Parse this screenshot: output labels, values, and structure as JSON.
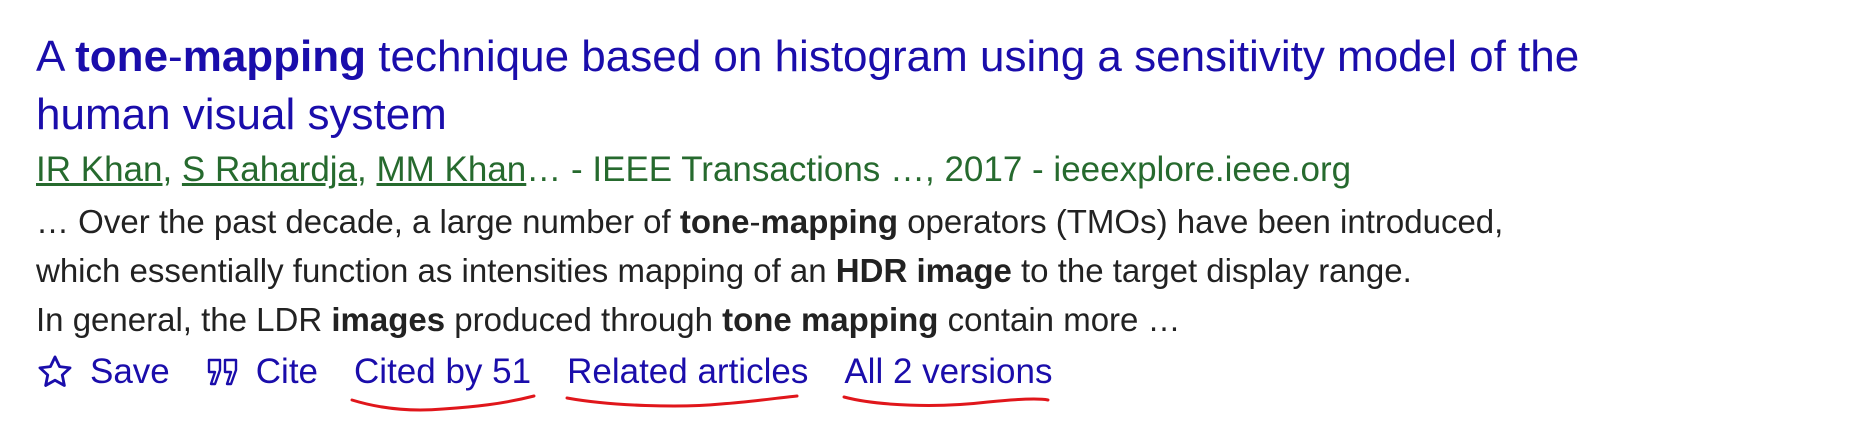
{
  "result": {
    "title_parts": {
      "p1": "A ",
      "p2": "tone",
      "p3": "-",
      "p4": "mapping",
      "p5": " technique based on histogram using a sensitivity model of the",
      "p6": "human visual system"
    },
    "authors": [
      "IR Khan",
      "S Rahardja",
      "MM Khan"
    ],
    "author_sep": ", ",
    "byline_rest": "… - IEEE Transactions …, 2017 - ieeexplore.ieee.org",
    "snippet": {
      "l1a": "… Over the past decade, a large number of ",
      "l1b": "tone",
      "l1c": "-",
      "l1d": "mapping",
      "l1e": " operators (TMOs) have been introduced,",
      "l2a": "which essentially function as intensities mapping of an ",
      "l2b": "HDR image",
      "l2c": " to the target display range.",
      "l3a": "In general, the LDR ",
      "l3b": "images",
      "l3c": " produced through ",
      "l3d": "tone mapping",
      "l3e": " contain more …"
    },
    "actions": {
      "save": "Save",
      "cite": "Cite",
      "cited_by": "Cited by 51",
      "related": "Related articles",
      "versions": "All 2 versions"
    }
  },
  "colors": {
    "link": "#1a0dab",
    "byline": "#266a2e",
    "annotation": "#e0161b"
  },
  "icons": {
    "save": "star-outline-icon",
    "cite": "quote-icon"
  }
}
